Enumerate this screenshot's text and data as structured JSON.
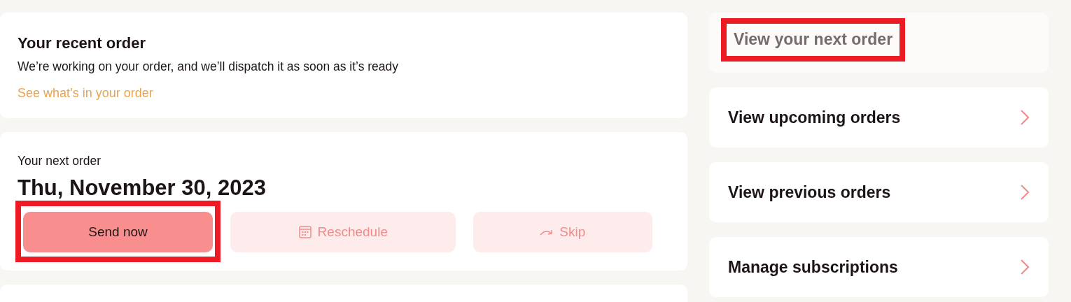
{
  "recent_order": {
    "title": "Your recent order",
    "message": "We’re working on your order, and we’ll dispatch it as soon as it’s ready",
    "link": "See what’s in your order"
  },
  "next_order": {
    "label": "Your next order",
    "date": "Thu, November 30, 2023",
    "actions": [
      {
        "label": "Send now",
        "kind": "primary",
        "highlighted": true
      },
      {
        "label": "Reschedule",
        "kind": "calendar",
        "highlighted": false
      },
      {
        "label": "Skip",
        "kind": "skip",
        "highlighted": false
      }
    ]
  },
  "nav": [
    {
      "label": "View your next order",
      "selected": true,
      "highlighted": true
    },
    {
      "label": "View upcoming orders",
      "selected": false,
      "highlighted": false
    },
    {
      "label": "View previous orders",
      "selected": false,
      "highlighted": false
    },
    {
      "label": "Manage subscriptions",
      "selected": false,
      "highlighted": false
    }
  ]
}
